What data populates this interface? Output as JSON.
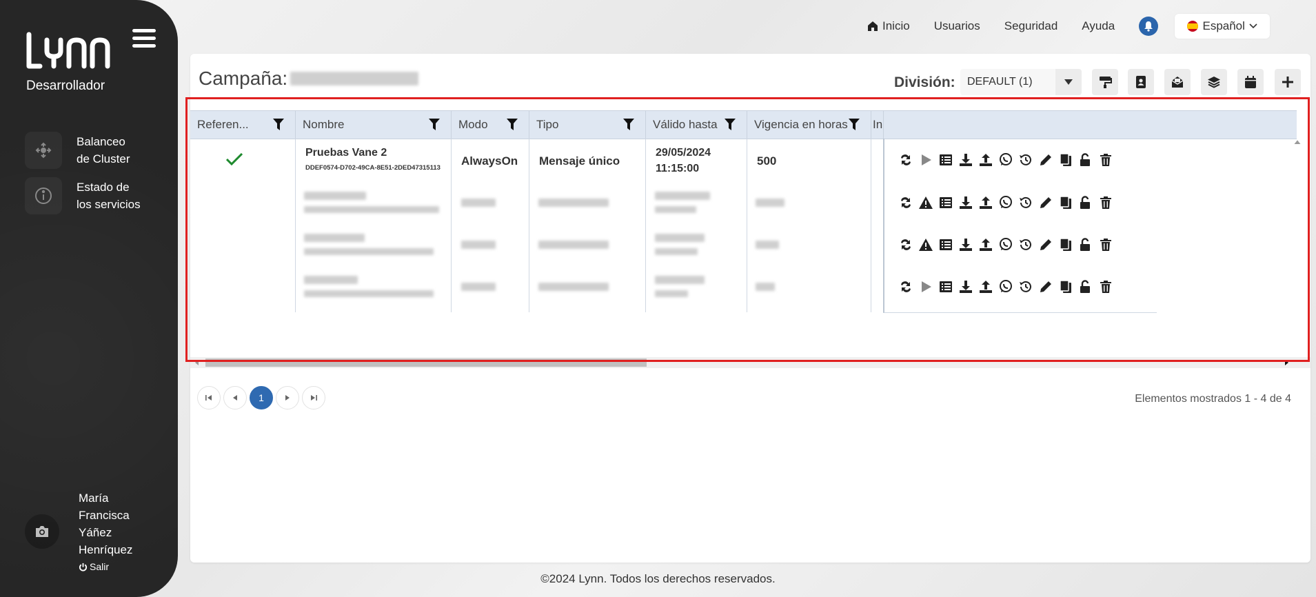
{
  "sidebar": {
    "brand": "LYNN",
    "role": "Desarrollador",
    "items": [
      {
        "label_line1": "Balanceo",
        "label_line2": "de Cluster"
      },
      {
        "label_line1": "Estado de",
        "label_line2": "los servicios"
      }
    ],
    "user": {
      "name_lines": [
        "María",
        "Francisca",
        "Yáñez",
        "Henríquez"
      ],
      "logout": "Salir"
    }
  },
  "topnav": {
    "home": "Inicio",
    "users": "Usuarios",
    "security": "Seguridad",
    "help": "Ayuda",
    "language": "Español"
  },
  "card": {
    "campaign_label": "Campaña:",
    "division_label": "División:",
    "division_value": "DEFAULT (1)"
  },
  "table": {
    "headers": [
      "Referen...",
      "Nombre",
      "Modo",
      "Tipo",
      "Válido hasta",
      "Vigencia en horas",
      "In"
    ],
    "row1": {
      "name": "Pruebas Vane 2",
      "id": "DDEF0574-D702-49CA-8E51-2DED47315113",
      "mode": "AlwaysOn",
      "type": "Mensaje único",
      "valid_date": "29/05/2024",
      "valid_time": "11:15:00",
      "hours": "500"
    }
  },
  "pagination": {
    "current": "1",
    "shown_text": "Elementos mostrados 1 - 4 de 4"
  },
  "footer": "©2024 Lynn. Todos los derechos reservados.",
  "colors": {
    "accent": "#2f6ab1",
    "sidebar": "#262626",
    "header_bg": "#dfe7f2",
    "highlight": "#e02020",
    "check": "#1e8a2e"
  }
}
